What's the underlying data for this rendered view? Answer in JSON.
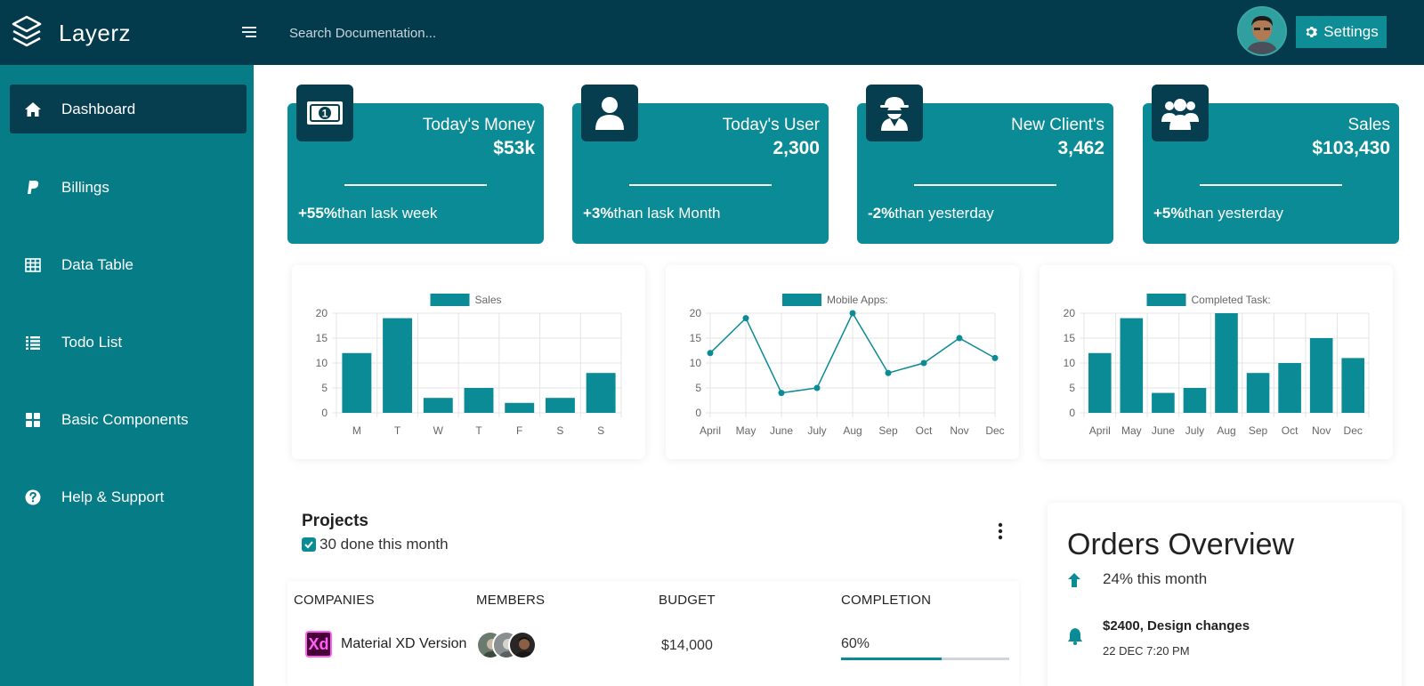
{
  "app": {
    "name": "Layerz"
  },
  "search": {
    "placeholder": "Search Documentation..."
  },
  "header": {
    "settings_label": "Settings"
  },
  "sidebar": {
    "items": [
      {
        "label": "Dashboard",
        "icon": "home-icon",
        "active": true
      },
      {
        "label": "Billings",
        "icon": "paypal-icon"
      },
      {
        "label": "Data Table",
        "icon": "table-icon"
      },
      {
        "label": "Todo List",
        "icon": "list-icon"
      },
      {
        "label": "Basic Components",
        "icon": "grid-icon"
      },
      {
        "label": "Help & Support",
        "icon": "question-circle-icon"
      }
    ]
  },
  "stats": [
    {
      "label": "Today's Money",
      "value": "$53k",
      "change": "+55%",
      "suffix": "than lask week",
      "icon": "money-bill-icon"
    },
    {
      "label": "Today's User",
      "value": "2,300",
      "change": "+3%",
      "suffix": "than lask Month",
      "icon": "user-icon"
    },
    {
      "label": "New Client's",
      "value": "3,462",
      "change": "-2%",
      "suffix": "than yesterday",
      "icon": "user-secret-icon"
    },
    {
      "label": "Sales",
      "value": "$103,430",
      "change": "+5%",
      "suffix": "than yesterday",
      "icon": "users-icon"
    }
  ],
  "colors": {
    "accent": "#0b8b95",
    "dark": "#063e50",
    "topbar": "#033a4c",
    "sidebar": "#067c87"
  },
  "chart_data": [
    {
      "type": "bar",
      "categories": [
        "M",
        "T",
        "W",
        "T",
        "F",
        "S",
        "S"
      ],
      "series": [
        {
          "name": "Sales",
          "values": [
            12,
            19,
            3,
            5,
            2,
            3,
            8
          ]
        }
      ],
      "ylim": [
        0,
        20
      ],
      "yticks": [
        0,
        5,
        10,
        15,
        20
      ],
      "grid": true,
      "legend": "top"
    },
    {
      "type": "line",
      "categories": [
        "April",
        "May",
        "June",
        "July",
        "Aug",
        "Sep",
        "Oct",
        "Nov",
        "Dec"
      ],
      "series": [
        {
          "name": "Mobile Apps:",
          "values": [
            12,
            19,
            4,
            5,
            20,
            8,
            10,
            15,
            11
          ]
        }
      ],
      "ylim": [
        0,
        20
      ],
      "yticks": [
        0,
        5,
        10,
        15,
        20
      ],
      "grid": true,
      "legend": "top"
    },
    {
      "type": "bar",
      "categories": [
        "April",
        "May",
        "June",
        "July",
        "Aug",
        "Sep",
        "Oct",
        "Nov",
        "Dec"
      ],
      "series": [
        {
          "name": "Completed Task:",
          "values": [
            12,
            19,
            4,
            5,
            20,
            8,
            10,
            15,
            11
          ]
        }
      ],
      "ylim": [
        0,
        20
      ],
      "yticks": [
        0,
        5,
        10,
        15,
        20
      ],
      "grid": true,
      "legend": "top"
    }
  ],
  "projects": {
    "title": "Projects",
    "subtitle": "30 done this month",
    "columns": [
      "COMPANIES",
      "MEMBERS",
      "BUDGET",
      "COMPLETION"
    ],
    "rows": [
      {
        "logo": "Xd",
        "company": "Material XD Version",
        "budget": "$14,000",
        "completion": "60%",
        "completion_value": 0.6
      }
    ]
  },
  "orders": {
    "title": "Orders Overview",
    "subtitle": "24% this month",
    "items": [
      {
        "title": "$2400, Design changes",
        "time": "22 DEC 7:20 PM"
      }
    ]
  }
}
